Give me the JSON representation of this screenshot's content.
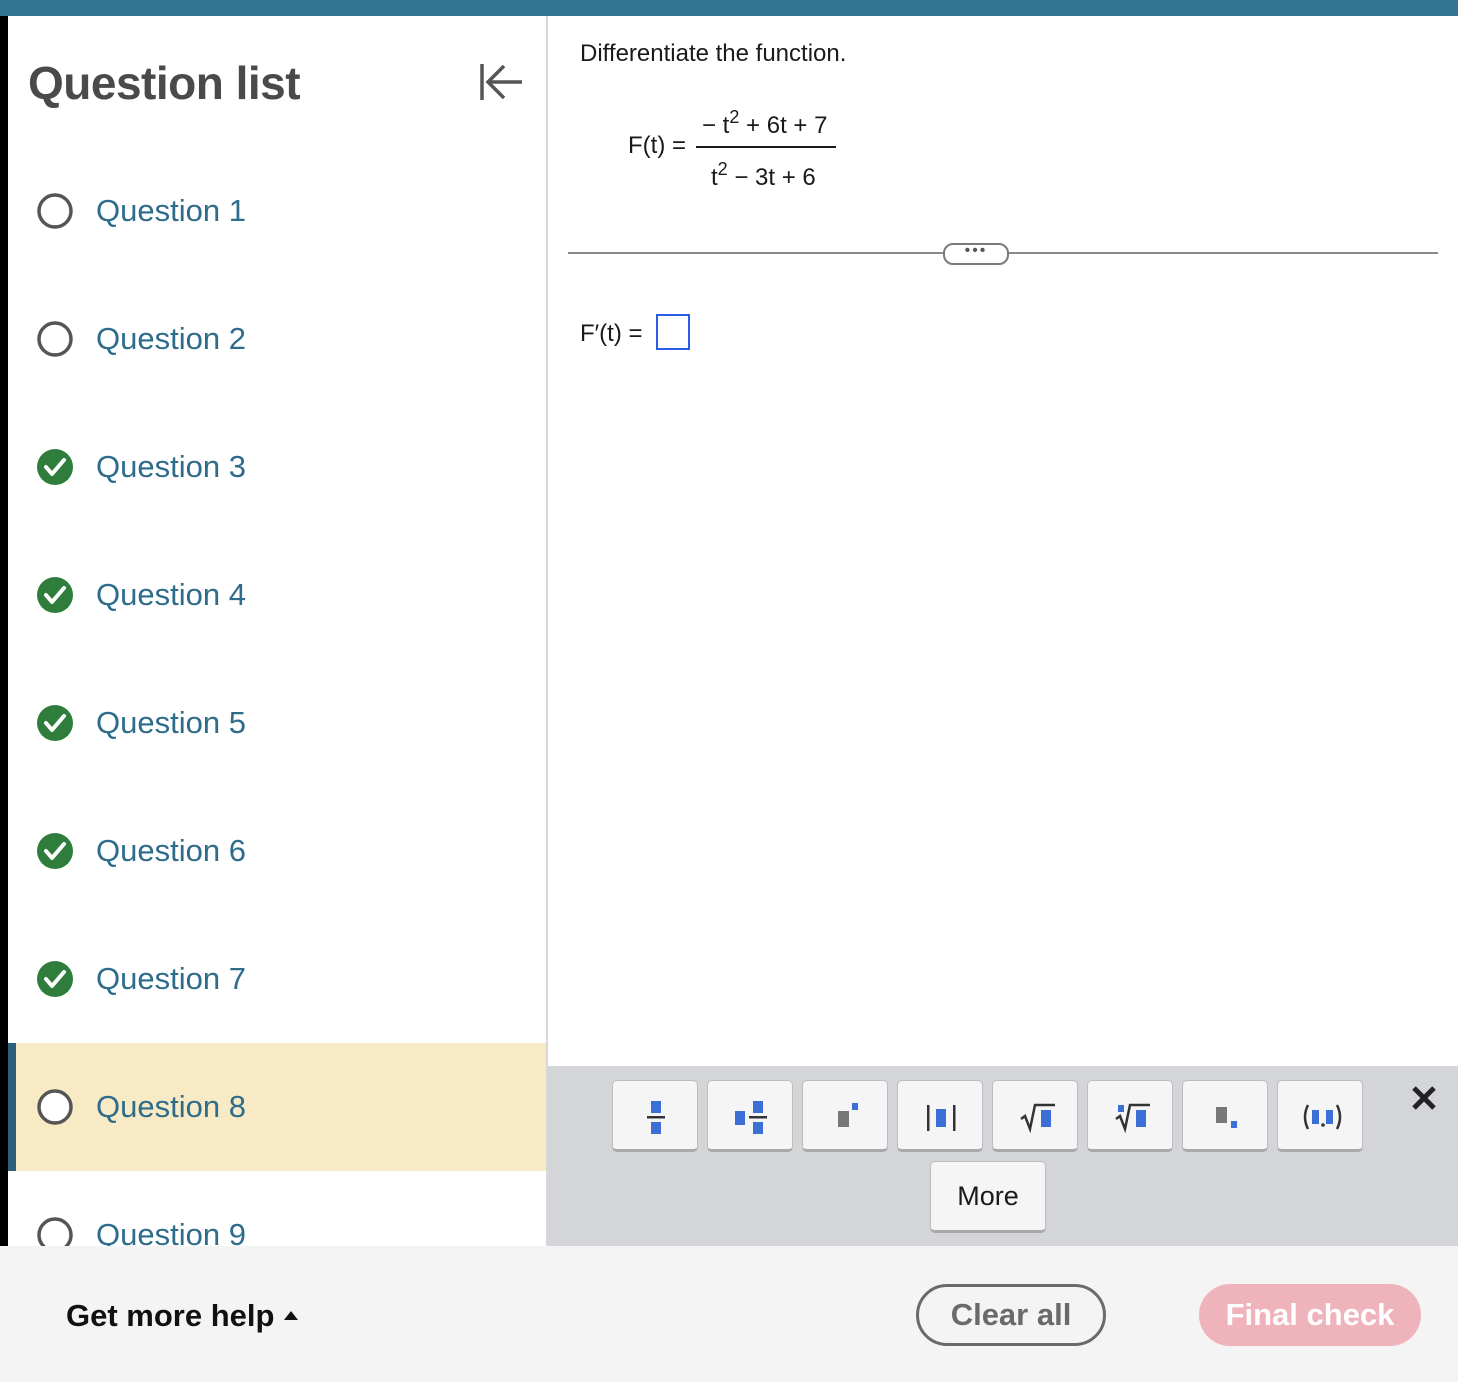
{
  "sidebar": {
    "title": "Question list",
    "collapse_icon": "collapse-left-icon",
    "questions": [
      {
        "label": "Question 1",
        "status": "unanswered"
      },
      {
        "label": "Question 2",
        "status": "unanswered"
      },
      {
        "label": "Question 3",
        "status": "completed"
      },
      {
        "label": "Question 4",
        "status": "completed"
      },
      {
        "label": "Question 5",
        "status": "completed"
      },
      {
        "label": "Question 6",
        "status": "completed"
      },
      {
        "label": "Question 7",
        "status": "completed"
      },
      {
        "label": "Question 8",
        "status": "unanswered",
        "active": true
      },
      {
        "label": "Question 9",
        "status": "unanswered"
      }
    ]
  },
  "problem": {
    "instruction": "Differentiate the function.",
    "function_lhs": "F(t) =",
    "numerator": {
      "pre": "− t",
      "exp": "2",
      "post": " + 6t + 7"
    },
    "denominator": {
      "pre": "t",
      "exp": "2",
      "post": " − 3t + 6"
    },
    "more_dots": "•••",
    "answer_lhs": "F′(t) ="
  },
  "toolbar": {
    "buttons": [
      "fraction-template",
      "mixed-number-template",
      "exponent-template",
      "absolute-value-template",
      "square-root-template",
      "nth-root-template",
      "subscript-template",
      "ordered-pair-template"
    ],
    "more_label": "More",
    "close_icon": "close-icon"
  },
  "footer": {
    "help_label": "Get more help",
    "clear_label": "Clear all",
    "final_label": "Final check"
  },
  "colors": {
    "top_bar": "#337494",
    "link": "#2e6c8c",
    "completed_check": "#2f7d3b",
    "active_row": "#f7eac5",
    "active_marker": "#2b5f7a",
    "answer_box": "#2b5ce6",
    "template_blue": "#3b6fd6",
    "final_check_bg": "#efb4bb"
  }
}
